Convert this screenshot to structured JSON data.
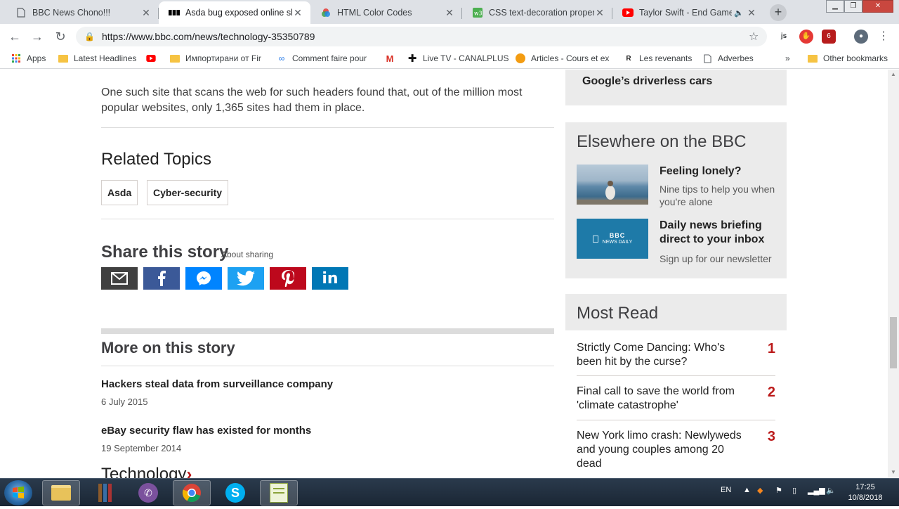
{
  "browser": {
    "tabs": [
      {
        "title": "BBC News Chono!!!",
        "active": false
      },
      {
        "title": "Asda bug exposed online shoppers",
        "active": true
      },
      {
        "title": "HTML Color Codes",
        "active": false
      },
      {
        "title": "CSS text-decoration property",
        "active": false
      },
      {
        "title": "Taylor Swift - End Game",
        "active": false
      }
    ],
    "url": "https://www.bbc.com/news/technology-35350789",
    "bookmarks": [
      "Apps",
      "Latest Headlines",
      "",
      "Импортирани от Fir",
      "Comment faire pour",
      "",
      "Live TV - CANALPLUS",
      "Articles - Cours et ex",
      "Les revenants",
      "Adverbes",
      "Other bookmarks"
    ],
    "ext_badge": "6",
    "ext_js_label": "js"
  },
  "article": {
    "paragraph": "One such site that scans the web for such headers found that, out of the million most popular websites, only 1,365 sites had them in place.",
    "related_title": "Related Topics",
    "topics": [
      "Asda",
      "Cyber-security"
    ],
    "share_title": "Share this story",
    "share_about": "About sharing",
    "more_title": "More on this story",
    "stories": [
      {
        "title": "Hackers steal data from surveillance company",
        "date": "6 July 2015"
      },
      {
        "title": "eBay security flaw has existed for months",
        "date": "19 September 2014"
      }
    ],
    "section_link": "Technology"
  },
  "sidebar": {
    "top_title": "Google’s driverless cars",
    "elsewhere_title": "Elsewhere on the BBC",
    "promos": [
      {
        "title": "Feeling lonely?",
        "summary": "Nine tips to help you when you're alone"
      },
      {
        "title": "Daily news briefing direct to your inbox",
        "summary": "Sign up for our newsletter",
        "logo_top": "BBC",
        "logo_bottom": "NEWS DAILY"
      }
    ],
    "most_read_title": "Most Read",
    "most_read": [
      {
        "title": "Strictly Come Dancing: Who's been hit by the curse?",
        "rank": "1"
      },
      {
        "title": "Final call to save the world from 'climate catastrophe'",
        "rank": "2"
      },
      {
        "title": "New York limo crash: Newlyweds and young couples among 20 dead",
        "rank": "3"
      }
    ]
  },
  "taskbar": {
    "lang": "EN",
    "time": "17:25",
    "date": "10/8/2018"
  },
  "colors": {
    "bbc_red": "#bb1919",
    "facebook": "#3b5998",
    "messenger": "#0084ff",
    "twitter": "#1da1f2",
    "pinterest": "#bd081c",
    "linkedin": "#0077b5",
    "email": "#404040"
  }
}
